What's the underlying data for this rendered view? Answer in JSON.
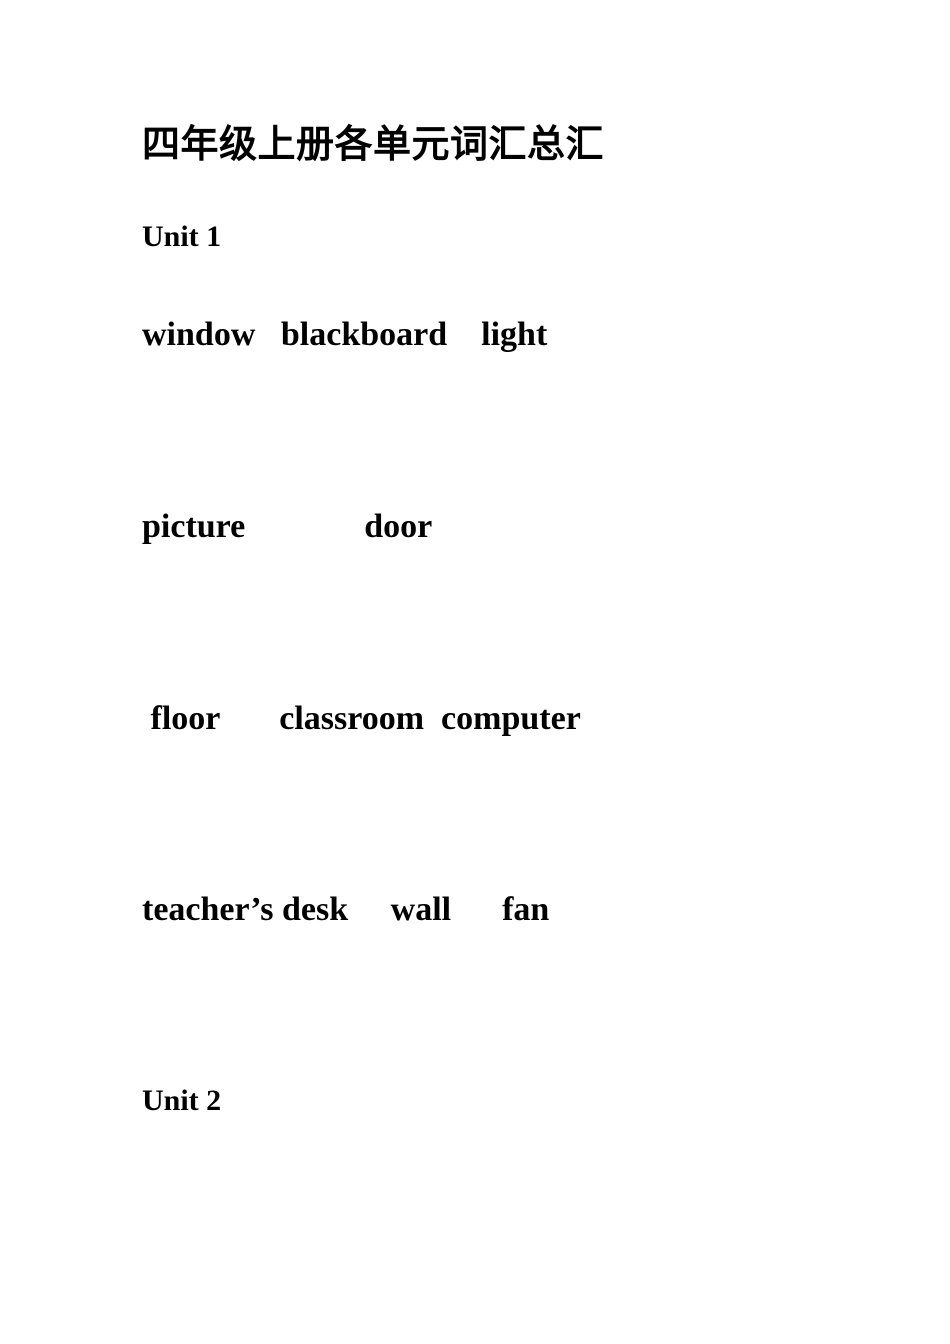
{
  "document": {
    "title": "四年级上册各单元词汇总汇",
    "page_background": "#ffffff",
    "text_color": "#000000"
  },
  "sections": [
    {
      "heading": "Unit 1",
      "rows": [
        "window   blackboard    light",
        "picture              door",
        " floor       classroom  computer",
        "teacher’s desk     wall      fan"
      ]
    },
    {
      "heading": "Unit 2",
      "rows": []
    }
  ],
  "vocabulary": {
    "unit1_words": [
      "window",
      "blackboard",
      "light",
      "picture",
      "door",
      "floor",
      "classroom",
      "computer",
      "teacher’s desk",
      "wall",
      "fan"
    ]
  }
}
